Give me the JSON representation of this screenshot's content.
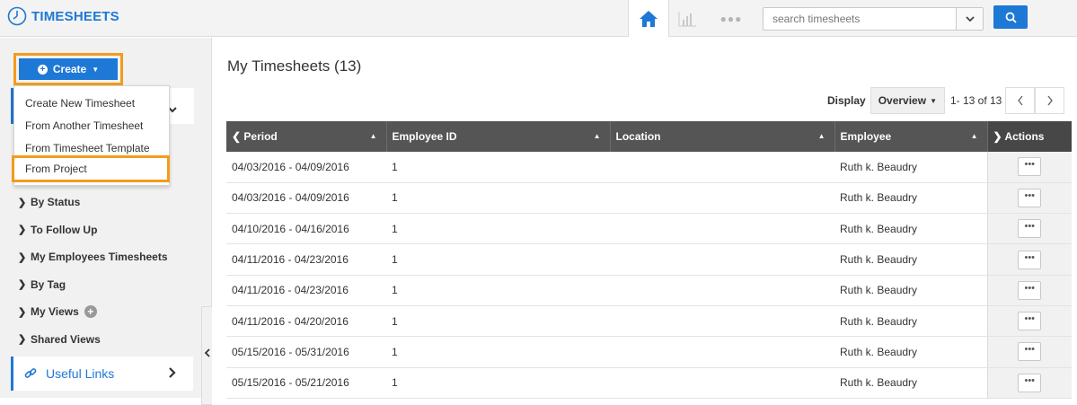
{
  "app": {
    "title": "TIMESHEETS"
  },
  "topbar": {
    "home_icon": "home-icon",
    "search_placeholder": "search timesheets",
    "search_button_icon": "search-icon"
  },
  "sidebar": {
    "create_label": "Create",
    "create_menu": [
      "Create New Timesheet",
      "From Another Timesheet",
      "From Timesheet Template",
      "From Project"
    ],
    "nav": [
      {
        "label": "By Status"
      },
      {
        "label": "To Follow Up"
      },
      {
        "label": "My Employees Timesheets"
      },
      {
        "label": "By Tag"
      },
      {
        "label": "My Views"
      },
      {
        "label": "Shared Views"
      }
    ],
    "useful_links": "Useful Links"
  },
  "main": {
    "title": "My Timesheets (13)",
    "display_label": "Display",
    "view": "Overview",
    "pager": "1- 13 of 13",
    "columns": [
      "Period",
      "Employee ID",
      "Location",
      "Employee",
      "Actions"
    ],
    "rows": [
      {
        "period": "04/03/2016 - 04/09/2016",
        "employee_id": "1",
        "location": "",
        "employee": "Ruth k. Beaudry"
      },
      {
        "period": "04/03/2016 - 04/09/2016",
        "employee_id": "1",
        "location": "",
        "employee": "Ruth k. Beaudry"
      },
      {
        "period": "04/10/2016 - 04/16/2016",
        "employee_id": "1",
        "location": "",
        "employee": "Ruth k. Beaudry"
      },
      {
        "period": "04/11/2016 - 04/23/2016",
        "employee_id": "1",
        "location": "",
        "employee": "Ruth k. Beaudry"
      },
      {
        "period": "04/11/2016 - 04/23/2016",
        "employee_id": "1",
        "location": "",
        "employee": "Ruth k. Beaudry"
      },
      {
        "period": "04/11/2016 - 04/20/2016",
        "employee_id": "1",
        "location": "",
        "employee": "Ruth k. Beaudry"
      },
      {
        "period": "05/15/2016 - 05/31/2016",
        "employee_id": "1",
        "location": "",
        "employee": "Ruth k. Beaudry"
      },
      {
        "period": "05/15/2016 - 05/21/2016",
        "employee_id": "1",
        "location": "",
        "employee": "Ruth k. Beaudry"
      }
    ],
    "row_action_label": "•••"
  },
  "colors": {
    "accent": "#1e78d6",
    "highlight": "#f39c1d",
    "header_bg": "#555555"
  }
}
